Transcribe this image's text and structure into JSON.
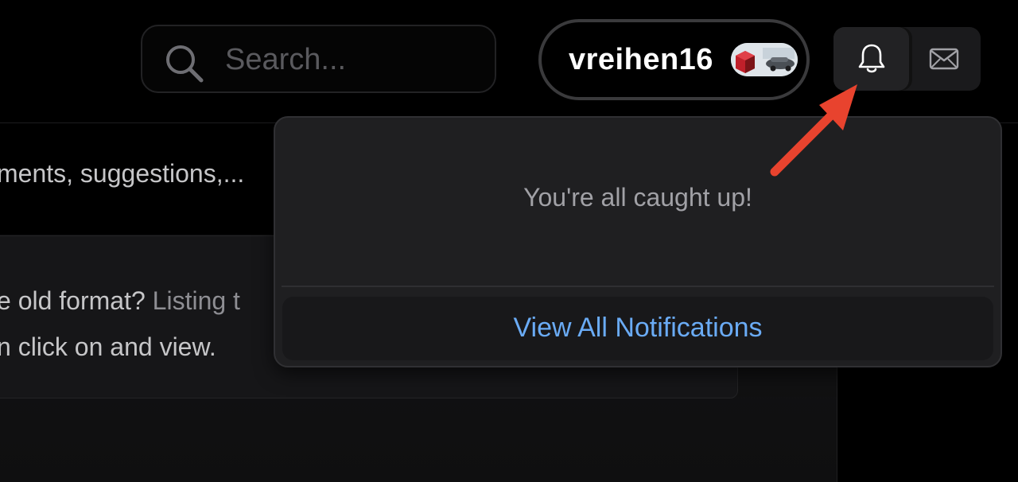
{
  "header": {
    "search": {
      "placeholder": "Search..."
    },
    "user": {
      "name": "vreihen16"
    },
    "icons": {
      "notifications": "bell-icon",
      "messages": "mail-icon"
    }
  },
  "background": {
    "line1": "ments, suggestions,...",
    "line2_main": "e old format? ",
    "line2_muted": "Listing t",
    "line3": "n click on and view."
  },
  "notifications": {
    "empty_message": "You're all caught up!",
    "view_all_label": "View All Notifications"
  },
  "colors": {
    "accent_link": "#6aabf5",
    "annotation_arrow": "#e8432e"
  }
}
